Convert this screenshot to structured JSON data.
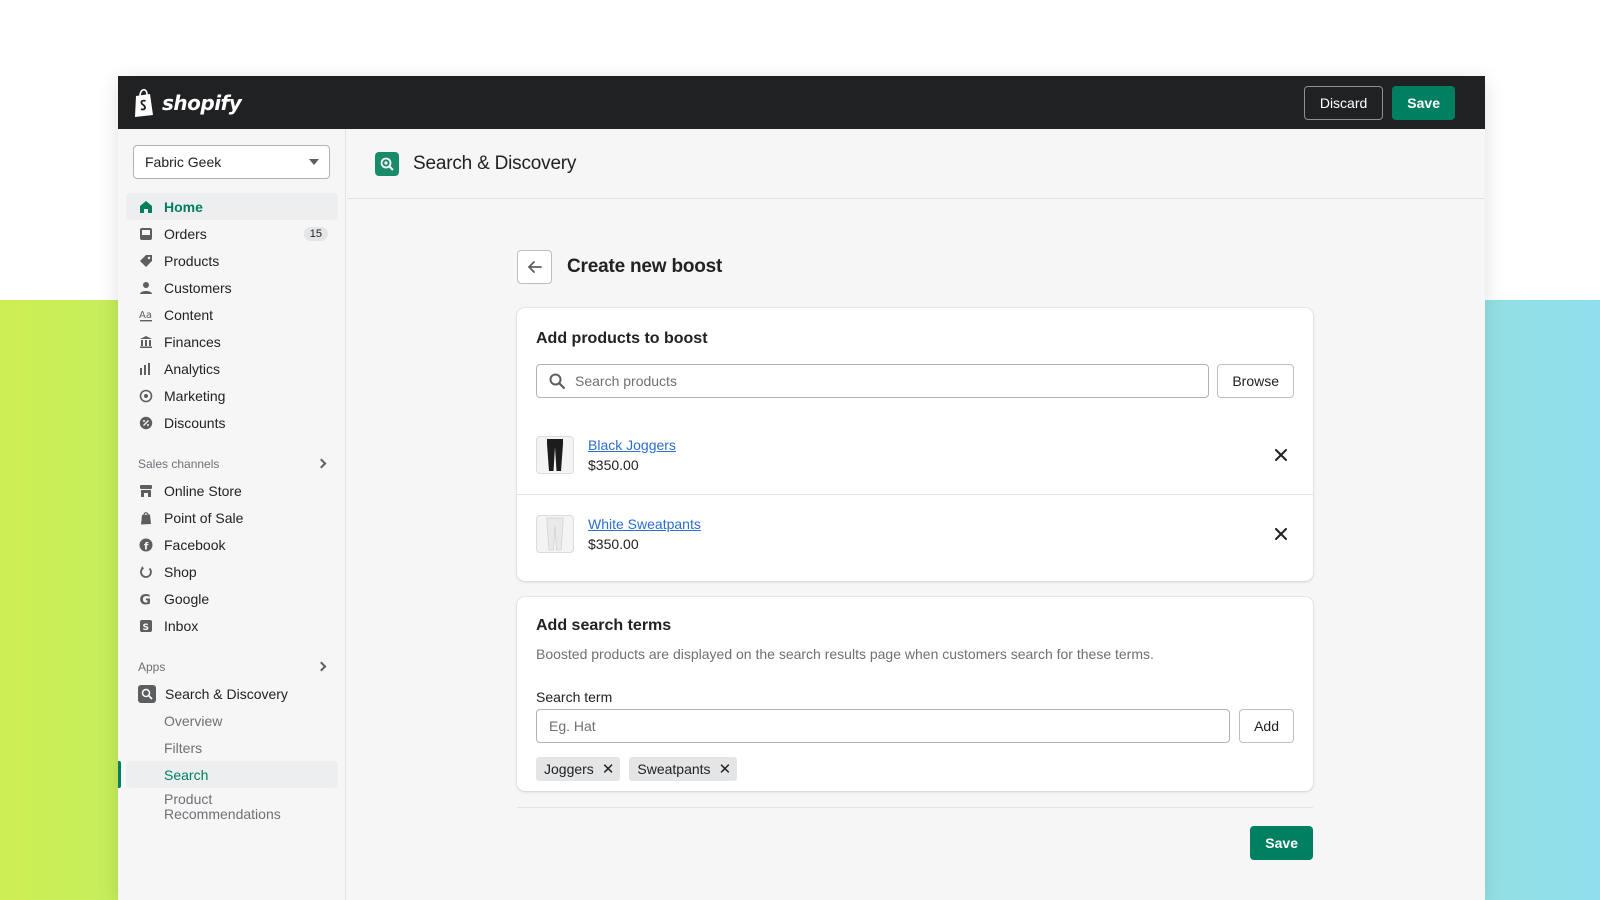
{
  "topbar": {
    "brand": "shopify",
    "discard_label": "Discard",
    "save_label": "Save"
  },
  "sidebar": {
    "store_name": "Fabric Geek",
    "items": [
      {
        "label": "Home",
        "icon": "home-icon"
      },
      {
        "label": "Orders",
        "icon": "inbox-icon",
        "badge": "15"
      },
      {
        "label": "Products",
        "icon": "tag-icon"
      },
      {
        "label": "Customers",
        "icon": "person-icon"
      },
      {
        "label": "Content",
        "icon": "content-icon"
      },
      {
        "label": "Finances",
        "icon": "bank-icon"
      },
      {
        "label": "Analytics",
        "icon": "bar-chart-icon"
      },
      {
        "label": "Marketing",
        "icon": "target-icon"
      },
      {
        "label": "Discounts",
        "icon": "discount-icon"
      }
    ],
    "sales_channels_label": "Sales channels",
    "channels": [
      {
        "label": "Online Store",
        "icon": "store-icon"
      },
      {
        "label": "Point of Sale",
        "icon": "pos-bag-icon"
      },
      {
        "label": "Facebook",
        "icon": "facebook-icon"
      },
      {
        "label": "Shop",
        "icon": "shop-icon"
      },
      {
        "label": "Google",
        "icon": "google-icon"
      },
      {
        "label": "Inbox",
        "icon": "inbox-app-icon"
      }
    ],
    "apps_label": "Apps",
    "app": {
      "label": "Search & Discovery",
      "icon": "search-discovery-icon"
    },
    "app_sub": [
      {
        "label": "Overview"
      },
      {
        "label": "Filters"
      },
      {
        "label": "Search",
        "selected": true
      },
      {
        "label": "Product Recommendations"
      }
    ]
  },
  "header": {
    "title": "Search & Discovery"
  },
  "page": {
    "title": "Create new boost",
    "products_card": {
      "title": "Add products to boost",
      "search_placeholder": "Search products",
      "browse_label": "Browse",
      "products": [
        {
          "name": "Black Joggers",
          "price": "$350.00"
        },
        {
          "name": "White Sweatpants",
          "price": "$350.00"
        }
      ]
    },
    "terms_card": {
      "title": "Add search terms",
      "description": "Boosted products are displayed on the search results page when customers search for these terms.",
      "field_label": "Search term",
      "placeholder": "Eg. Hat",
      "add_label": "Add",
      "tags": [
        "Joggers",
        "Sweatpants"
      ]
    },
    "save_label": "Save"
  },
  "colors": {
    "accent": "#008060",
    "topbar": "#202123",
    "link": "#2c6ecb"
  }
}
